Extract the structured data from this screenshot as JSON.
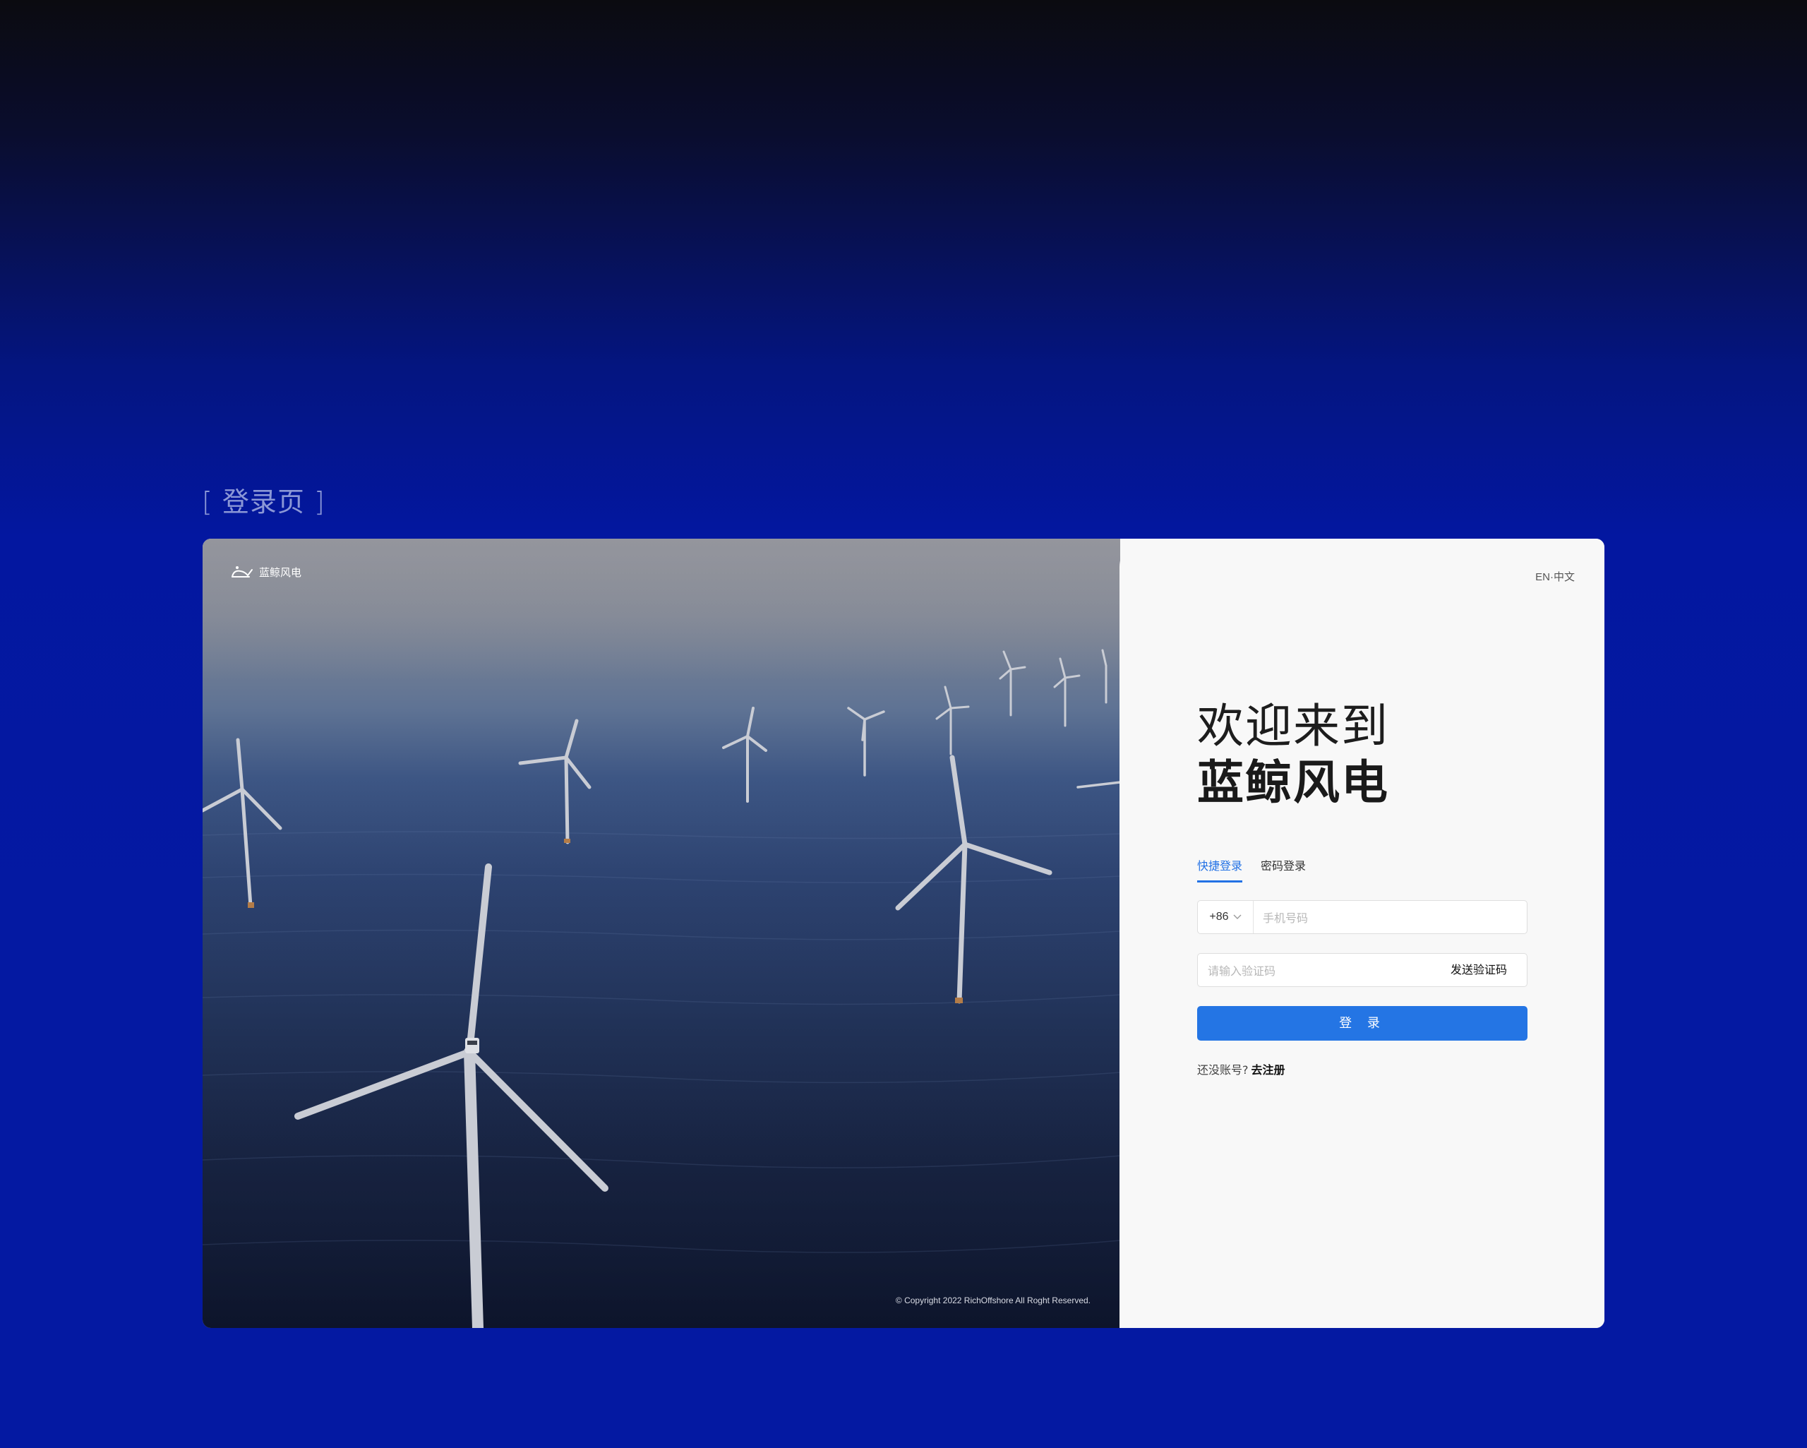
{
  "section_label": "[ 登录页 ]",
  "brand": {
    "name": "蓝鲸风电",
    "logo_icon": "whale-logo-icon"
  },
  "copyright": "© Copyright 2022 RichOffshore All Roght Reserved.",
  "language_switch": "EN·中文",
  "welcome": {
    "line1": "欢迎来到",
    "line2": "蓝鲸风电"
  },
  "tabs": [
    {
      "label": "快捷登录",
      "active": true
    },
    {
      "label": "密码登录",
      "active": false
    }
  ],
  "phone": {
    "country_code": "+86",
    "placeholder": "手机号码"
  },
  "code": {
    "placeholder": "请输入验证码",
    "send_label": "发送验证码"
  },
  "login_button": "登 录",
  "register": {
    "prompt": "还没账号?",
    "link": "去注册"
  },
  "colors": {
    "accent": "#2475e4",
    "page_bg": "#0419a2",
    "panel_bg": "#f8f8f8"
  }
}
